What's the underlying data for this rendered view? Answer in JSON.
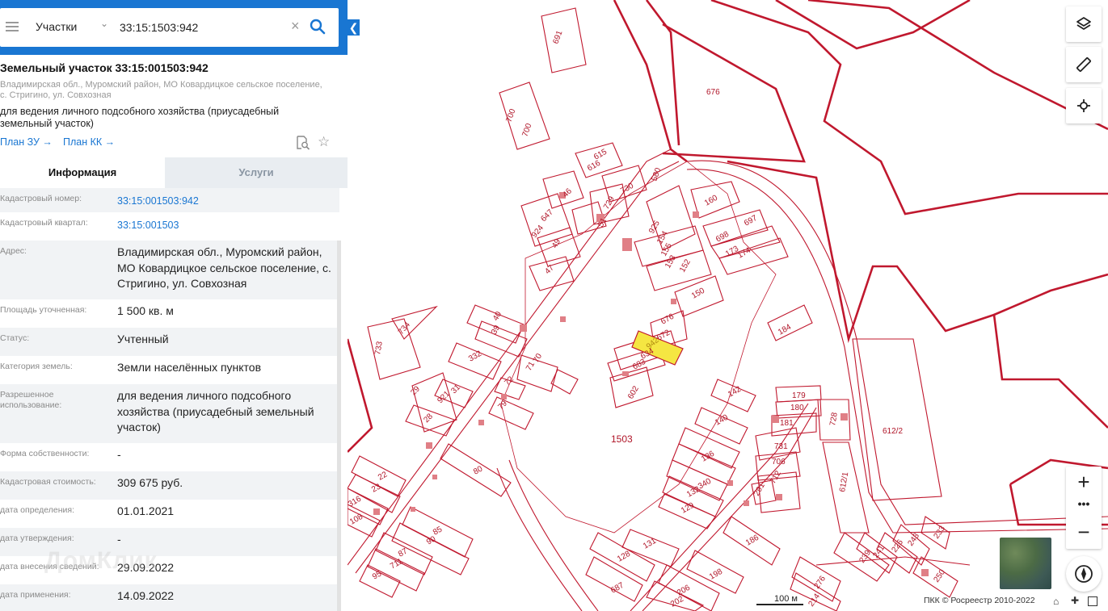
{
  "search": {
    "type_label": "Участки",
    "query": "33:15:1503:942"
  },
  "parcel": {
    "title": "Земельный участок 33:15:001503:942",
    "address": "Владимирская обл., Муромский район, МО Ковардицкое сельское поселение, с. Стригино, ул. Совхозная",
    "usage": "для ведения личного подсобного хозяйства (приусадебный земельный участок)",
    "plan_zu": "План ЗУ →",
    "plan_kk": "План КК →"
  },
  "tabs": {
    "info": "Информация",
    "services": "Услуги"
  },
  "info_rows": [
    {
      "label": "Кадастровый номер:",
      "value": "33:15:001503:942",
      "link": true
    },
    {
      "label": "Кадастровый квартал:",
      "value": "33:15:001503",
      "link": true
    },
    {
      "label": "Адрес:",
      "value": "Владимирская обл., Муромский район, МО Ковардицкое сельское поселение, с. Стригино, ул. Совхозная"
    },
    {
      "label": "Площадь уточненная:",
      "value": "1 500 кв. м"
    },
    {
      "label": "Статус:",
      "value": "Учтенный"
    },
    {
      "label": "Категория земель:",
      "value": "Земли населённых пунктов"
    },
    {
      "label": "Разрешенное использование:",
      "value": "для ведения личного подсобного хозяйства (приусадебный земельный участок)"
    },
    {
      "label": "Форма собственности:",
      "value": "-"
    },
    {
      "label": "Кадастровая стоимость:",
      "value": "309 675 руб."
    },
    {
      "label": "дата определения:",
      "value": "01.01.2021"
    },
    {
      "label": "дата утверждения:",
      "value": "-"
    },
    {
      "label": "дата внесения сведений:",
      "value": "29.09.2022"
    },
    {
      "label": "дата применения:",
      "value": "14.09.2022"
    }
  ],
  "watermark": "ДомКлик",
  "map": {
    "quarter_label": "1503",
    "highlight_label": "942",
    "parcel_labels": [
      "691",
      "700",
      "676",
      "615",
      "616",
      "730",
      "729",
      "51",
      "46",
      "647",
      "924",
      "580",
      "160",
      "925",
      "154",
      "155",
      "153",
      "152",
      "697",
      "698",
      "173",
      "174",
      "49",
      "47",
      "150",
      "184",
      "40",
      "39",
      "332",
      "70",
      "71",
      "676",
      "672",
      "634",
      "683",
      "602",
      "142",
      "179",
      "180",
      "181",
      "728",
      "612/2",
      "29",
      "921",
      "31",
      "28",
      "72",
      "79",
      "140",
      "136",
      "731",
      "706",
      "712",
      "340",
      "132",
      "129",
      "291",
      "612/1",
      "80",
      "22",
      "23",
      "316",
      "108",
      "85",
      "90",
      "87",
      "711",
      "95",
      "131",
      "128",
      "198",
      "186",
      "687",
      "206",
      "202",
      "276",
      "214",
      "239",
      "241",
      "226",
      "243",
      "233",
      "250",
      "733",
      "734"
    ],
    "scale_label": "100 м",
    "copyright": "ПКК © Росреестр 2010-2022",
    "colors": {
      "parcel_line": "#c0182e",
      "highlight_fill": "#f5e642",
      "accent": "#1976d2",
      "building": "#e07f86"
    }
  },
  "controls": {
    "zoom_in": "+",
    "zoom_more": "•••",
    "zoom_out": "−"
  }
}
